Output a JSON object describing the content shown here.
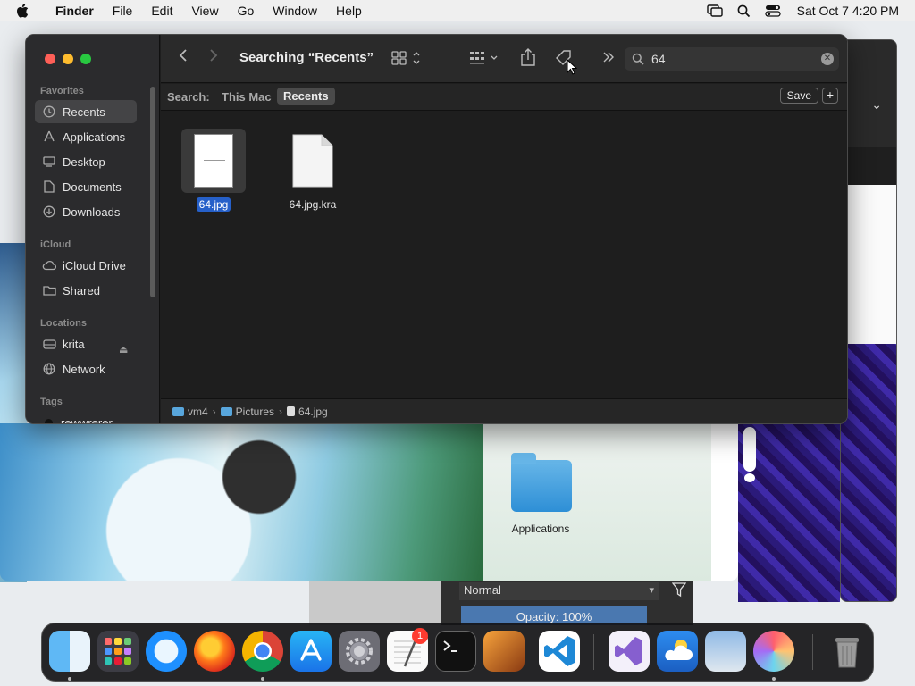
{
  "menubar": {
    "app_name": "Finder",
    "menus": [
      "File",
      "Edit",
      "View",
      "Go",
      "Window",
      "Help"
    ],
    "clock": "Sat Oct 7  4:20 PM"
  },
  "finder": {
    "title": "Searching “Recents”",
    "search": {
      "value": "64"
    },
    "sidebar": {
      "favorites_header": "Favorites",
      "favorites": [
        {
          "label": "Recents",
          "icon": "clock-icon",
          "selected": true
        },
        {
          "label": "Applications",
          "icon": "applications-icon"
        },
        {
          "label": "Desktop",
          "icon": "desktop-icon"
        },
        {
          "label": "Documents",
          "icon": "document-icon"
        },
        {
          "label": "Downloads",
          "icon": "download-icon"
        }
      ],
      "icloud_header": "iCloud",
      "icloud": [
        {
          "label": "iCloud Drive",
          "icon": "cloud-icon"
        },
        {
          "label": "Shared",
          "icon": "shared-folder-icon"
        }
      ],
      "locations_header": "Locations",
      "locations": [
        {
          "label": "krita",
          "icon": "drive-icon"
        },
        {
          "label": "Network",
          "icon": "network-icon"
        }
      ],
      "tags_header": "Tags",
      "tags": [
        {
          "label": "rewwrerer",
          "color": "#111111"
        }
      ]
    },
    "scope": {
      "label": "Search:",
      "this_mac": "This Mac",
      "recents": "Recents",
      "save": "Save",
      "plus": "+"
    },
    "files": [
      {
        "name": "64.jpg",
        "selected": true
      },
      {
        "name": "64.jpg.kra",
        "selected": false
      }
    ],
    "path": [
      "vm4",
      "Pictures",
      "64.jpg"
    ]
  },
  "desktop": {
    "applications_label": "Applications"
  },
  "krita": {
    "blend_mode": "Normal",
    "opacity": "Opacity:  100%"
  },
  "dock": {
    "apps": [
      "Finder",
      "Launchpad",
      "Safari",
      "Firefox",
      "Google Chrome",
      "App Store",
      "System Settings",
      "TextEdit",
      "Terminal",
      "GarageBand",
      "Visual Studio Code",
      "Visual Studio",
      "Weather",
      "Preview",
      "Krita",
      "Trash"
    ],
    "settings_badge": "1"
  },
  "colors": {
    "accent": "#2660c9",
    "close": "#fe5f57",
    "minimize": "#febc2e",
    "maximize": "#28c840",
    "badge": "#ff3b30"
  }
}
